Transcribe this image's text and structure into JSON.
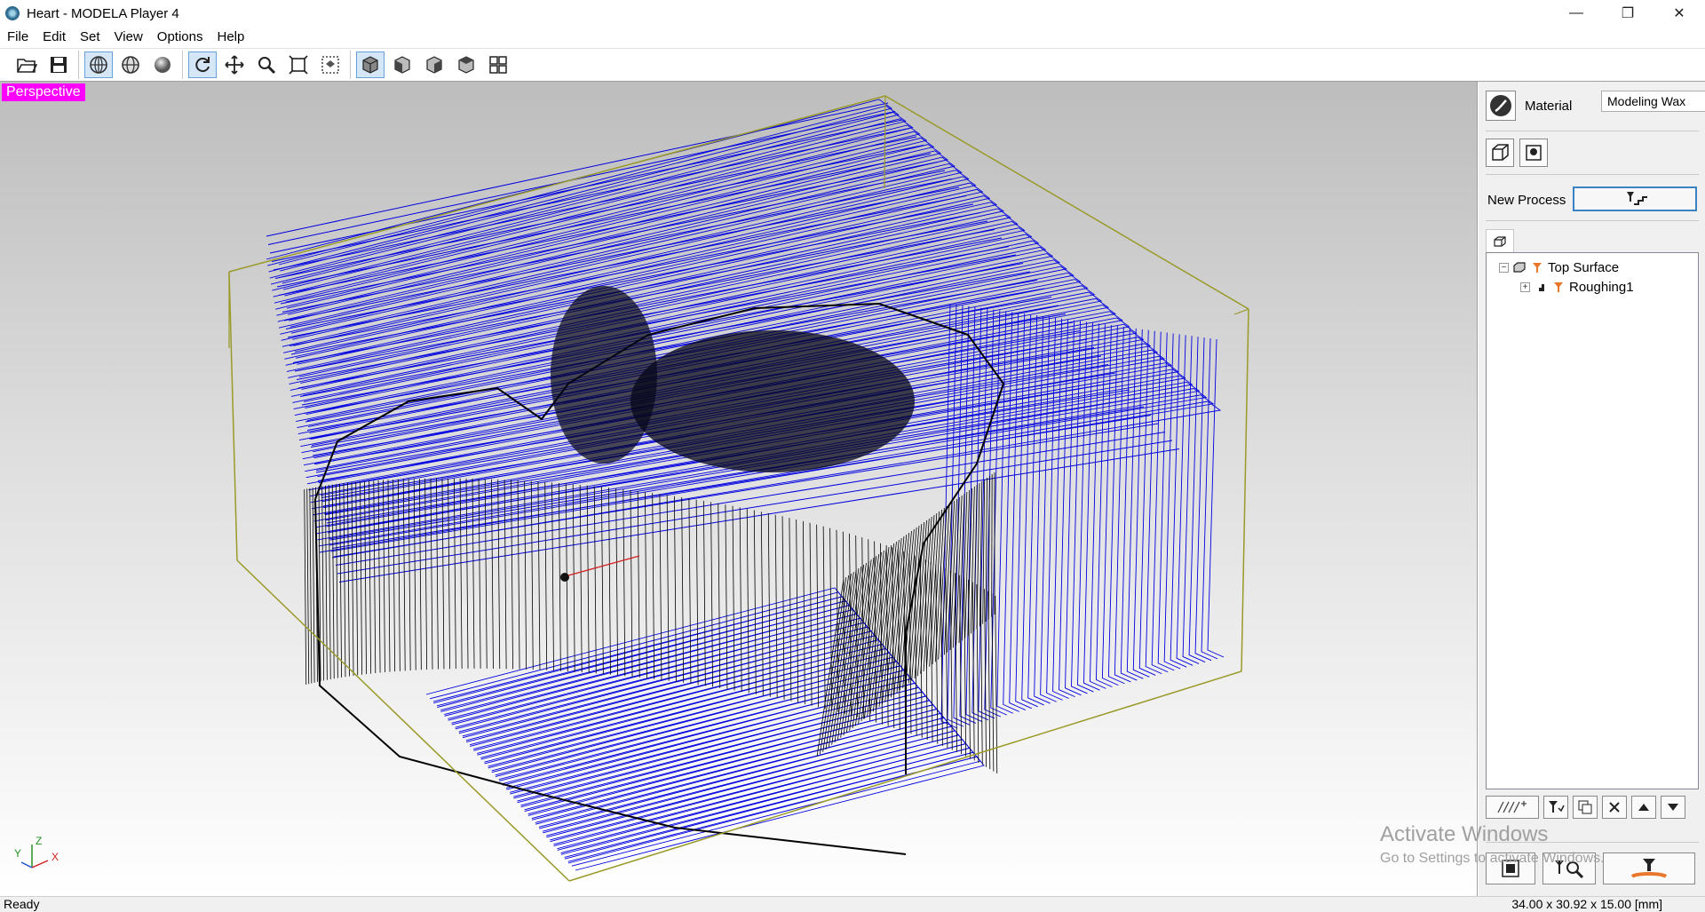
{
  "window": {
    "title": "Heart - MODELA Player 4",
    "minimize": "—",
    "restore": "❐",
    "close": "✕"
  },
  "menu": [
    "File",
    "Edit",
    "Set",
    "View",
    "Options",
    "Help"
  ],
  "toolbar": {
    "icons": [
      "open-icon",
      "save-icon",
      "wireframe-icon",
      "hidden-line-icon",
      "shaded-icon",
      "rotate-icon",
      "pan-icon",
      "zoom-icon",
      "fit-icon",
      "zoom-window-icon",
      "view-perspective-icon",
      "view-front-icon",
      "view-side-icon",
      "view-top-icon",
      "view-multi-icon"
    ]
  },
  "viewport": {
    "label": "Perspective",
    "axis": {
      "x": "X",
      "y": "Y",
      "z": "Z"
    }
  },
  "panel": {
    "material_label": "Material",
    "material_value": "Modeling Wax",
    "new_process_label": "New Process",
    "tree": [
      {
        "label": "Top Surface"
      },
      {
        "label": "Roughing1"
      }
    ]
  },
  "watermark": {
    "line1": "Activate Windows",
    "line2": "Go to Settings to activate Windows."
  },
  "status": {
    "left": "Ready",
    "right": "34.00 x 30.92 x 15.00 [mm]"
  },
  "colors": {
    "toolpath": "#0000e0",
    "mesh": "#000000",
    "bounding_box": "#9a9a2a",
    "perspective_badge": "#ff00ff",
    "accent": "#3b82c4"
  }
}
